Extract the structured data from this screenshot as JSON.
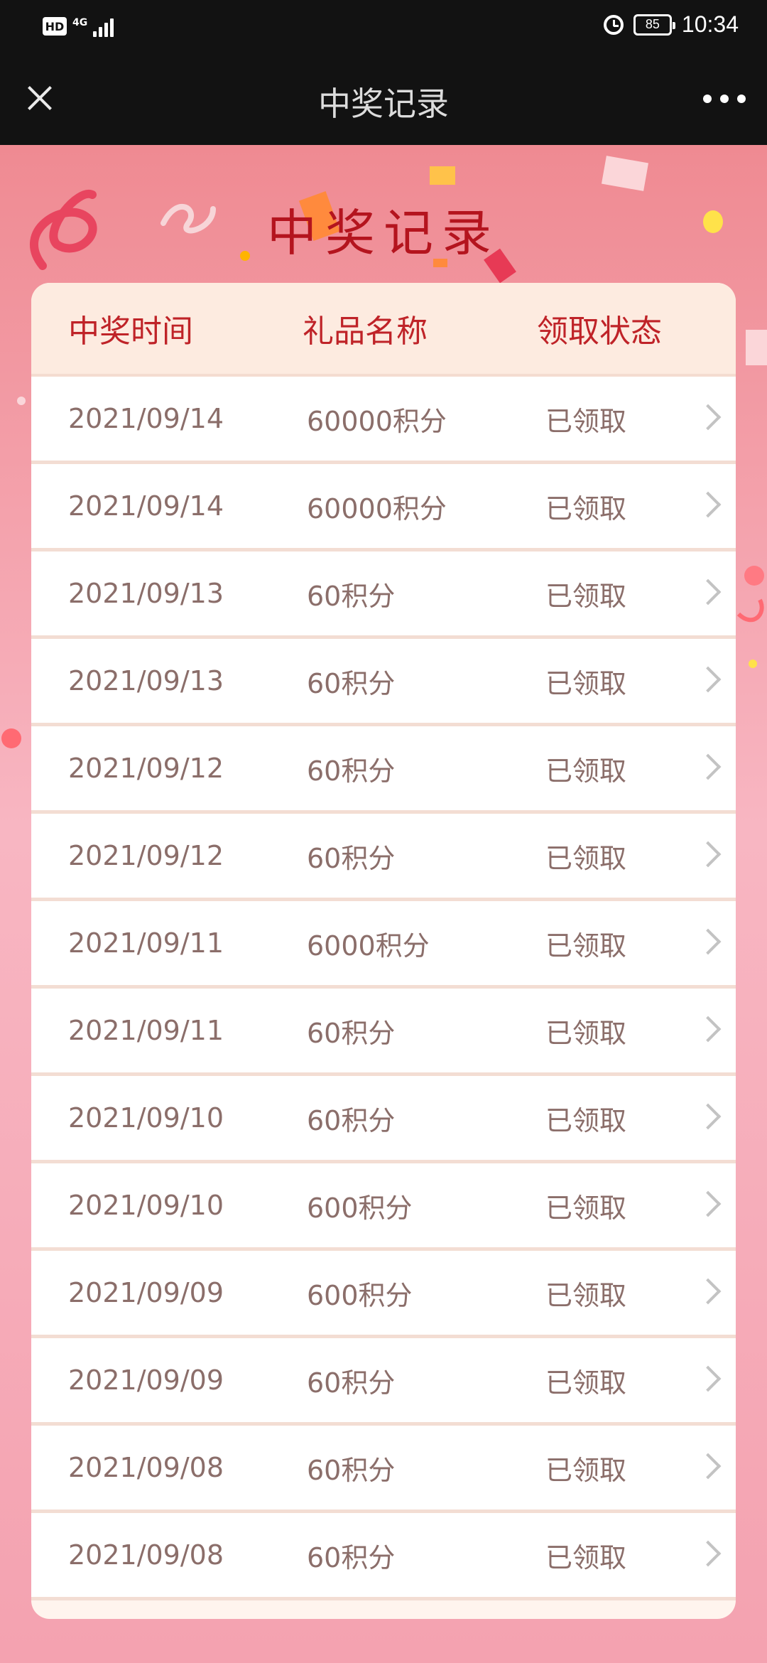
{
  "status_bar": {
    "hd": "HD",
    "network": "4G",
    "battery": "85",
    "time": "10:34",
    "icons": [
      "hd-icon",
      "signal-icon",
      "alarm-icon",
      "battery-icon"
    ]
  },
  "nav": {
    "title": "中奖记录",
    "close_icon": "close-icon",
    "more_icon": "more-icon"
  },
  "page": {
    "title": "中奖记录"
  },
  "table": {
    "headers": [
      "中奖时间",
      "礼品名称",
      "领取状态"
    ],
    "rows": [
      {
        "date": "2021/09/14",
        "prize": "60000积分",
        "status": "已领取"
      },
      {
        "date": "2021/09/14",
        "prize": "60000积分",
        "status": "已领取"
      },
      {
        "date": "2021/09/13",
        "prize": "60积分",
        "status": "已领取"
      },
      {
        "date": "2021/09/13",
        "prize": "60积分",
        "status": "已领取"
      },
      {
        "date": "2021/09/12",
        "prize": "60积分",
        "status": "已领取"
      },
      {
        "date": "2021/09/12",
        "prize": "60积分",
        "status": "已领取"
      },
      {
        "date": "2021/09/11",
        "prize": "6000积分",
        "status": "已领取"
      },
      {
        "date": "2021/09/11",
        "prize": "60积分",
        "status": "已领取"
      },
      {
        "date": "2021/09/10",
        "prize": "60积分",
        "status": "已领取"
      },
      {
        "date": "2021/09/10",
        "prize": "600积分",
        "status": "已领取"
      },
      {
        "date": "2021/09/09",
        "prize": "600积分",
        "status": "已领取"
      },
      {
        "date": "2021/09/09",
        "prize": "60积分",
        "status": "已领取"
      },
      {
        "date": "2021/09/08",
        "prize": "60积分",
        "status": "已领取"
      },
      {
        "date": "2021/09/08",
        "prize": "60积分",
        "status": "已领取"
      }
    ]
  },
  "colors": {
    "header_text": "#bf2328",
    "title_red": "#b4141e",
    "cell_text": "#8b6e6a",
    "background_pink": "#f7a7b0"
  }
}
